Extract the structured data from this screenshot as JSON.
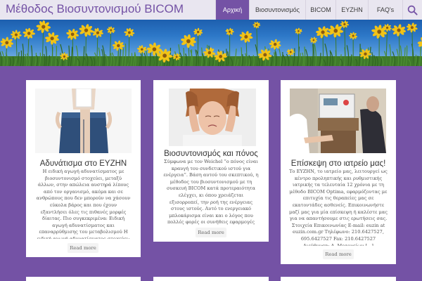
{
  "header": {
    "site_title": "Μέθοδος Βιοσυντονισμού BICOM",
    "nav": [
      {
        "label": "Αρχική",
        "active": true
      },
      {
        "label": "Βιοσυντονισμός",
        "active": false
      },
      {
        "label": "BICOM",
        "active": false
      },
      {
        "label": "EYZHN",
        "active": false
      },
      {
        "label": "FAQ's",
        "active": false
      }
    ],
    "search_icon": "search-icon"
  },
  "colors": {
    "accent": "#7452a5",
    "header_bg": "#e9e6f0",
    "card_bg": "#ffffff"
  },
  "posts": [
    {
      "title": "Αδυνάτισμα στο ΕΥΖΗΝ",
      "excerpt": "Η ειδική αγωγή αδυνατίσματος με βιοσυντονισμό στοχεύει, μεταξύ άλλων, στην απώλεια αυστηρά λίπους από τον οργανισμό, ακόμα και σε ανθρώπους που δεν μπορούν να χάσουν εύκολα βάρος και που έχουν εξαντλήσει όλες τις πιθανές μορφές δίαιτας. Πιο συγκεκριμένα: Ειδική αγωγή αδυνατίσματος και επαναρρύθμισης του μεταβολισμού Η ειδική αγωγή αδυνατίσματος στοχεύει: στην απώλεια αυστηρά λίπους από τον [...]",
      "read_more": "Read more"
    },
    {
      "title": "Βιοσυντονισμός και πόνος",
      "excerpt": "Σύμφωνα με τον Weichel “ο πόνος είναι κραυγή του συνδετικού ιστού για ενέργεια”. Βάση αυτού του σκεπτικού, η μέθοδος του βιοσυντονισμού με τη συσκευή BICOM κατά προτεραιότητα ελέγχει, κι όπου χρειάζεται εξισορροπεί, την ροή της ενέργειας στους ιστούς. Αυτό το ενεργειακό μπλοκάρισμα είναι και ο λόγος που πολλές φορές οι συνήθεις εφαρμογές φυσικοθεραπείας στα [...]",
      "read_more": "Read more"
    },
    {
      "title": "Επίσκεψη στο ιατρείο μας!",
      "excerpt": "Το ΕΥΖΗΝ, το ιατρείο μας, λειτουργεί ως κέντρο προληπτικής και ρυθμιστικής ιατρικής τα τελευταία 12 χρόνια με τη μέθοδο BICOM Optima, εφαρμόζοντας με επιτυχία τις θεραπείες μας σε εκατοντάδες ασθενείς. Επικοινωνήστε μαζί μας για μία επίσκεψη ή καλέστε μας για να απαντήσουμε στις ερωτήσεις σας. Στοιχεία Επικοινωνίας E-mail: euzin at euzin.com.gr Τηλέφωνο: 210.6427527, 695.6427527 Fax: 210.6427527 Διεύθυνση: Λ. Μεσογείων [...]",
      "read_more": "Read more"
    }
  ]
}
